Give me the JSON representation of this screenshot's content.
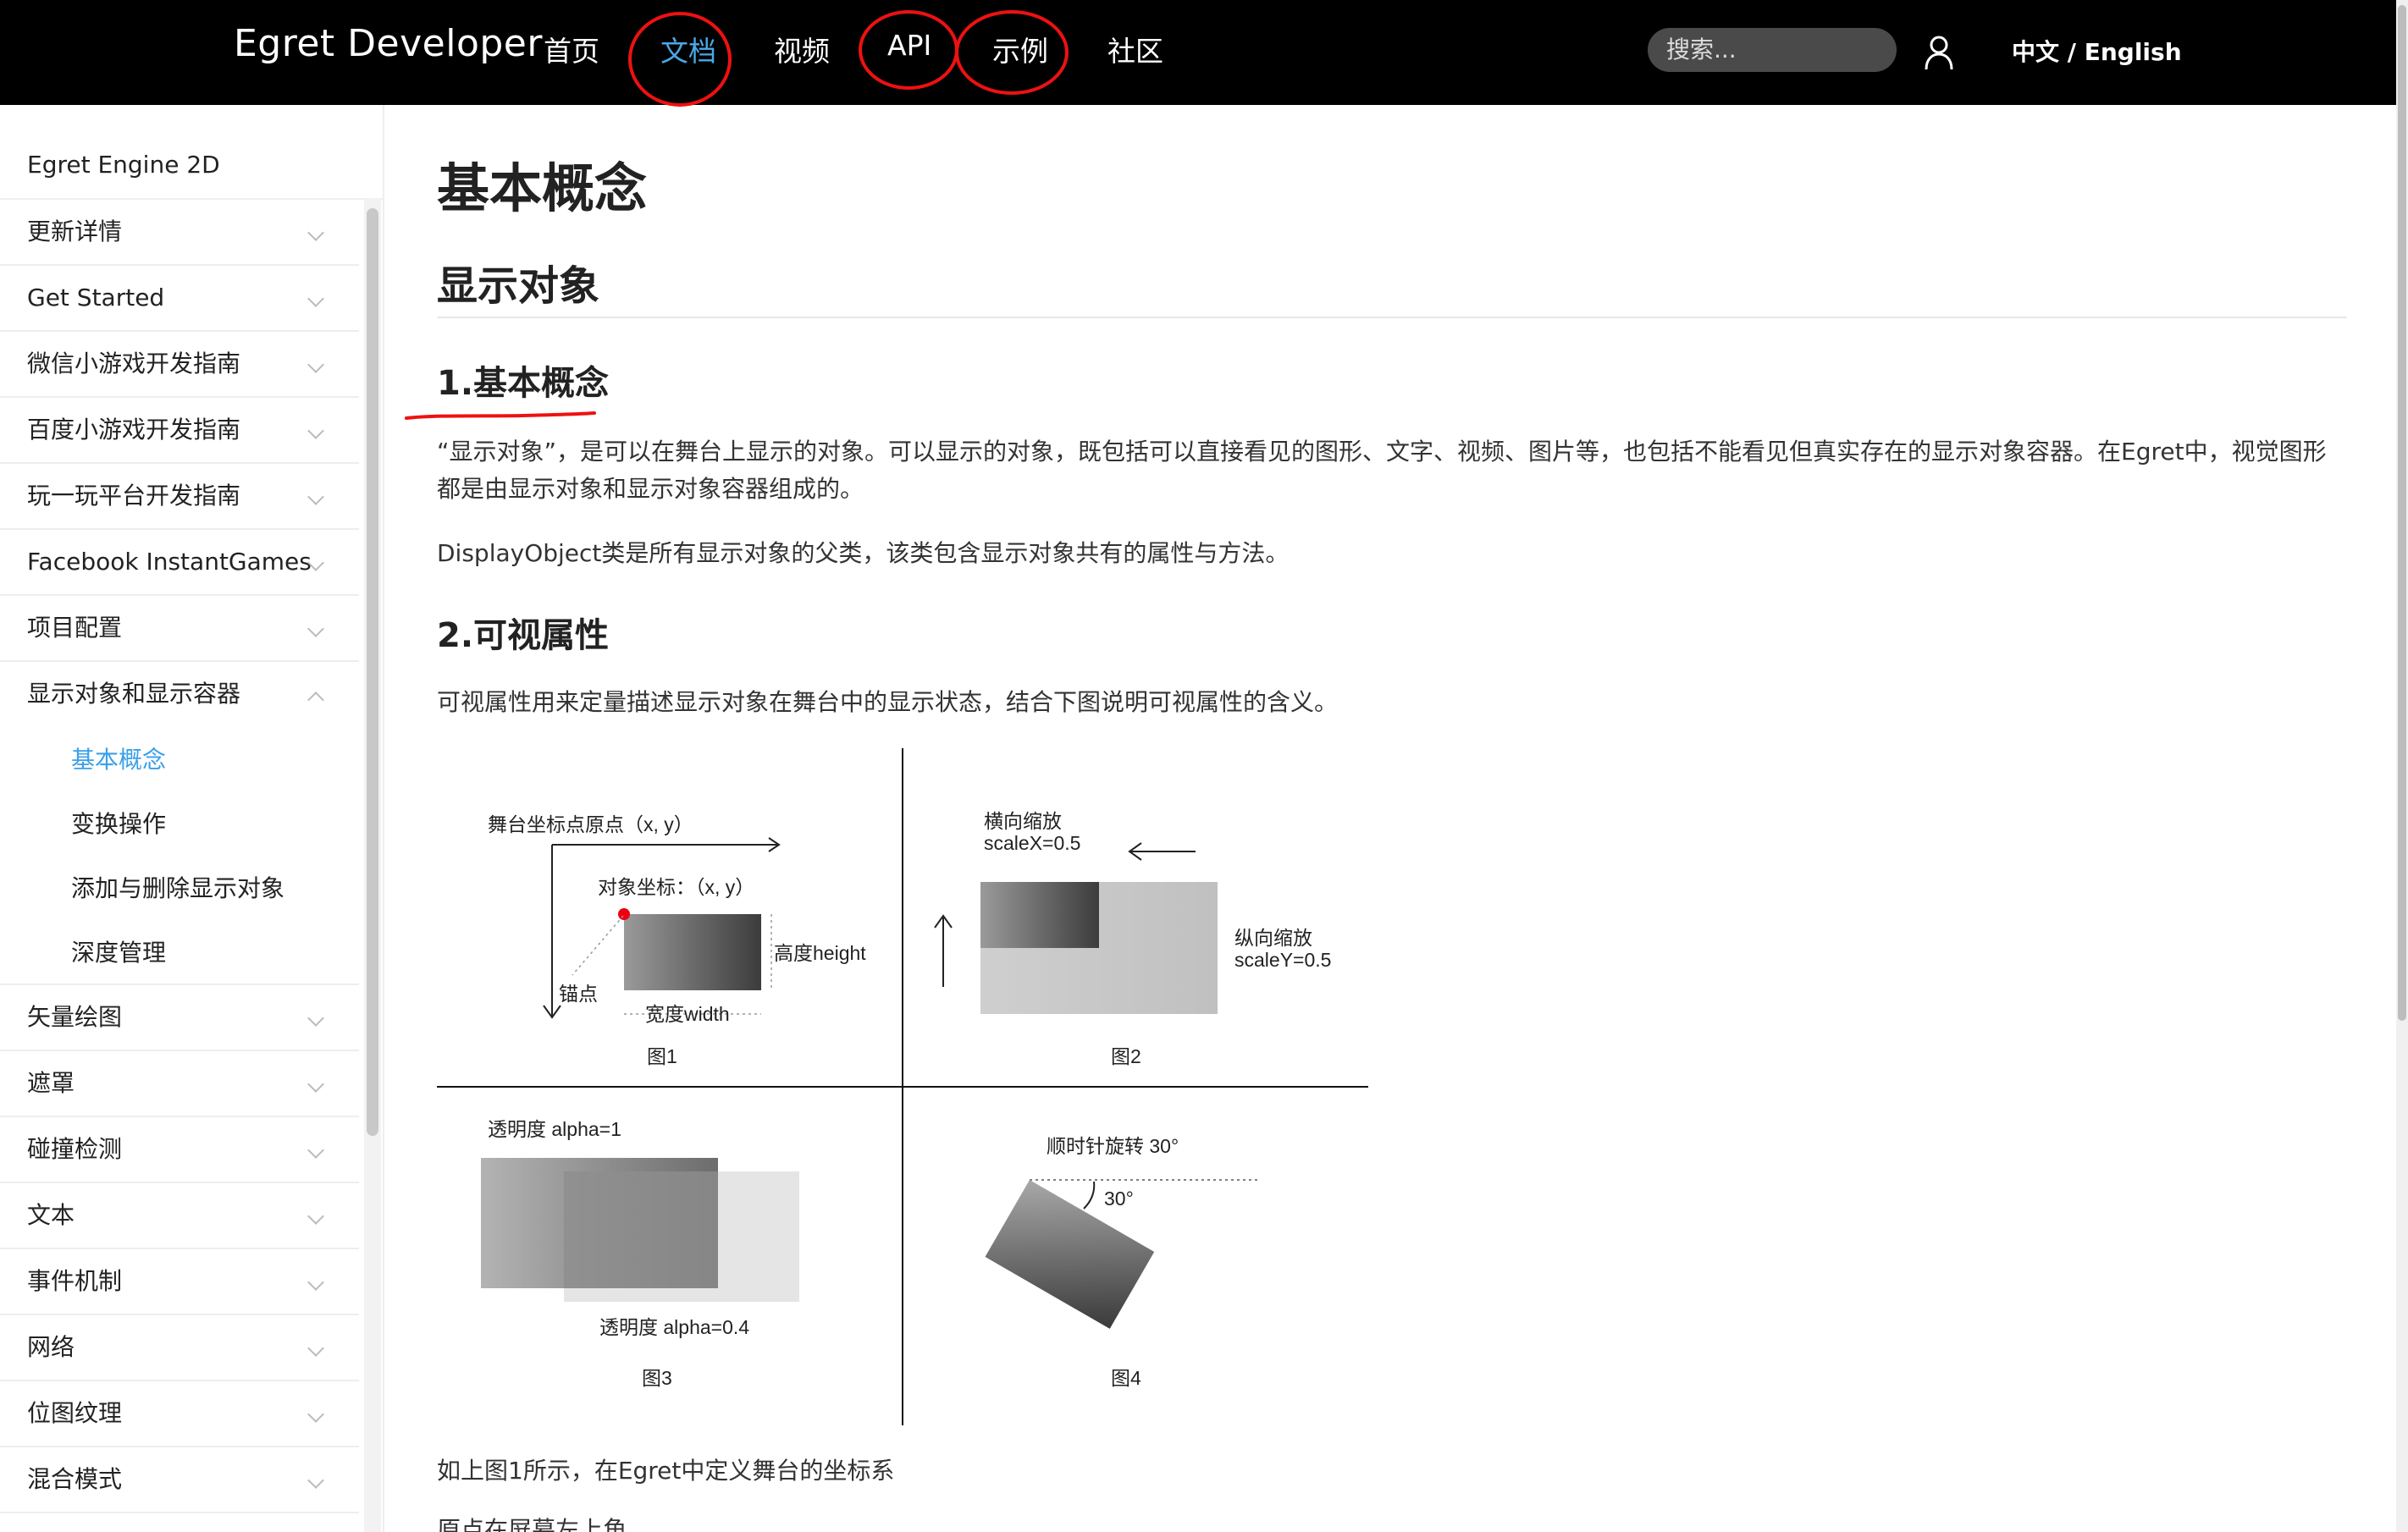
{
  "topbar": {
    "brand": "Egret Developer",
    "nav": [
      "首页",
      "文档",
      "视频",
      "API",
      "示例",
      "社区"
    ],
    "active_nav": "文档",
    "search_placeholder": "搜索...",
    "lang": "中文 / English",
    "annotation_color": "#e11111"
  },
  "sidebar": {
    "product": "Egret Engine 2D",
    "items_before": [
      "更新详情",
      "Get Started",
      "微信小游戏开发指南",
      "百度小游戏开发指南",
      "玩一玩平台开发指南",
      "Facebook InstantGames",
      "项目配置"
    ],
    "expanded_item": "显示对象和显示容器",
    "sub_items": [
      "基本概念",
      "变换操作",
      "添加与删除显示对象",
      "深度管理"
    ],
    "active_sub": "基本概念",
    "items_after": [
      "矢量绘图",
      "遮罩",
      "碰撞检测",
      "文本",
      "事件机制",
      "网络",
      "位图纹理",
      "混合模式"
    ]
  },
  "content": {
    "title": "基本概念",
    "section": "显示对象",
    "h_basic": "1.基本概念",
    "p1": "“显示对象”，是可以在舞台上显示的对象。可以显示的对象，既包括可以直接看见的图形、文字、视频、图片等，也包括不能看见但真实存在的显示对象容器。在Egret中，视觉图形都是由显示对象和显示对象容器组成的。",
    "p2": "DisplayObject类是所有显示对象的父类，该类包含显示对象共有的属性与方法。",
    "h_visual": "2.可视属性",
    "p3": "可视属性用来定量描述显示对象在舞台中的显示状态，结合下图说明可视属性的含义。",
    "p4": "如上图1所示，在Egret中定义舞台的坐标系",
    "p5": "原点在屏幕左上角"
  },
  "figure": {
    "fig1": {
      "stage_origin": "舞台坐标点原点（x, y）",
      "obj_coord": "对象坐标：（x, y）",
      "anchor": "锚点",
      "height": "高度height",
      "width": "宽度width",
      "caption": "图1"
    },
    "fig2": {
      "scalex_cn": "横向缩放",
      "scalex": "scaleX=0.5",
      "scaley_cn": "纵向缩放",
      "scaley": "scaleY=0.5",
      "caption": "图2"
    },
    "fig3": {
      "alpha1": "透明度 alpha=1",
      "alpha04": "透明度 alpha=0.4",
      "caption": "图3"
    },
    "fig4": {
      "rotate": "顺时针旋转 30°",
      "angle": "30°",
      "caption": "图4"
    }
  }
}
